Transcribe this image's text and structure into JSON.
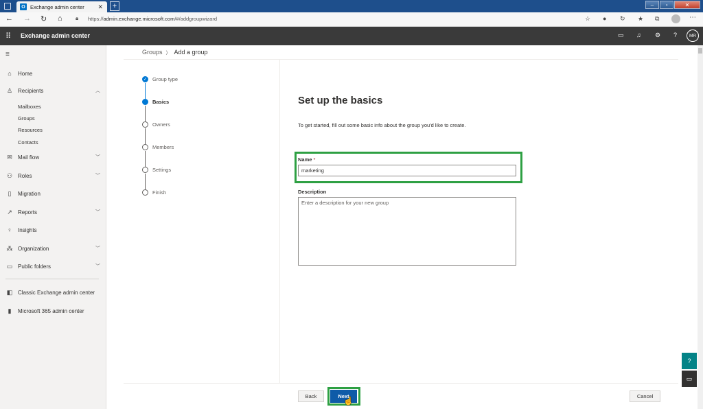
{
  "browser": {
    "tab_title": "Exchange admin center",
    "tab_icon_letter": "O",
    "url_prefix": "https://",
    "url_host": "admin.exchange.microsoft.com",
    "url_path": "/#/addgroupwizard"
  },
  "app": {
    "title": "Exchange admin center",
    "user_initials": "MR"
  },
  "sidebar": {
    "items": [
      {
        "label": "Home",
        "icon": "home-icon"
      },
      {
        "label": "Recipients",
        "icon": "person-icon",
        "expanded": true
      },
      {
        "label": "Mail flow",
        "icon": "mail-icon"
      },
      {
        "label": "Roles",
        "icon": "roles-icon"
      },
      {
        "label": "Migration",
        "icon": "migration-icon"
      },
      {
        "label": "Reports",
        "icon": "reports-icon"
      },
      {
        "label": "Insights",
        "icon": "lightbulb-icon"
      },
      {
        "label": "Organization",
        "icon": "organization-icon"
      },
      {
        "label": "Public folders",
        "icon": "folder-icon"
      },
      {
        "label": "Classic Exchange admin center",
        "icon": "exchange-icon"
      },
      {
        "label": "Microsoft 365 admin center",
        "icon": "office-icon"
      }
    ],
    "recipients_sub": [
      "Mailboxes",
      "Groups",
      "Resources",
      "Contacts"
    ]
  },
  "breadcrumb": {
    "parent": "Groups",
    "current": "Add a group"
  },
  "wizard": {
    "steps": [
      {
        "label": "Group type",
        "state": "done"
      },
      {
        "label": "Basics",
        "state": "active"
      },
      {
        "label": "Owners",
        "state": "pending"
      },
      {
        "label": "Members",
        "state": "pending"
      },
      {
        "label": "Settings",
        "state": "pending"
      },
      {
        "label": "Finish",
        "state": "pending"
      }
    ]
  },
  "form": {
    "title": "Set up the basics",
    "description": "To get started, fill out some basic info about the group you'd like to create.",
    "name_label": "Name",
    "required_mark": " *",
    "name_value": "marketing",
    "description_label": "Description",
    "description_placeholder": "Enter a description for your new group"
  },
  "footer": {
    "back": "Back",
    "next": "Next",
    "cancel": "Cancel"
  },
  "colors": {
    "accent": "#0078d4",
    "highlight": "#2ea043",
    "header_bg": "#3a3a3a"
  }
}
